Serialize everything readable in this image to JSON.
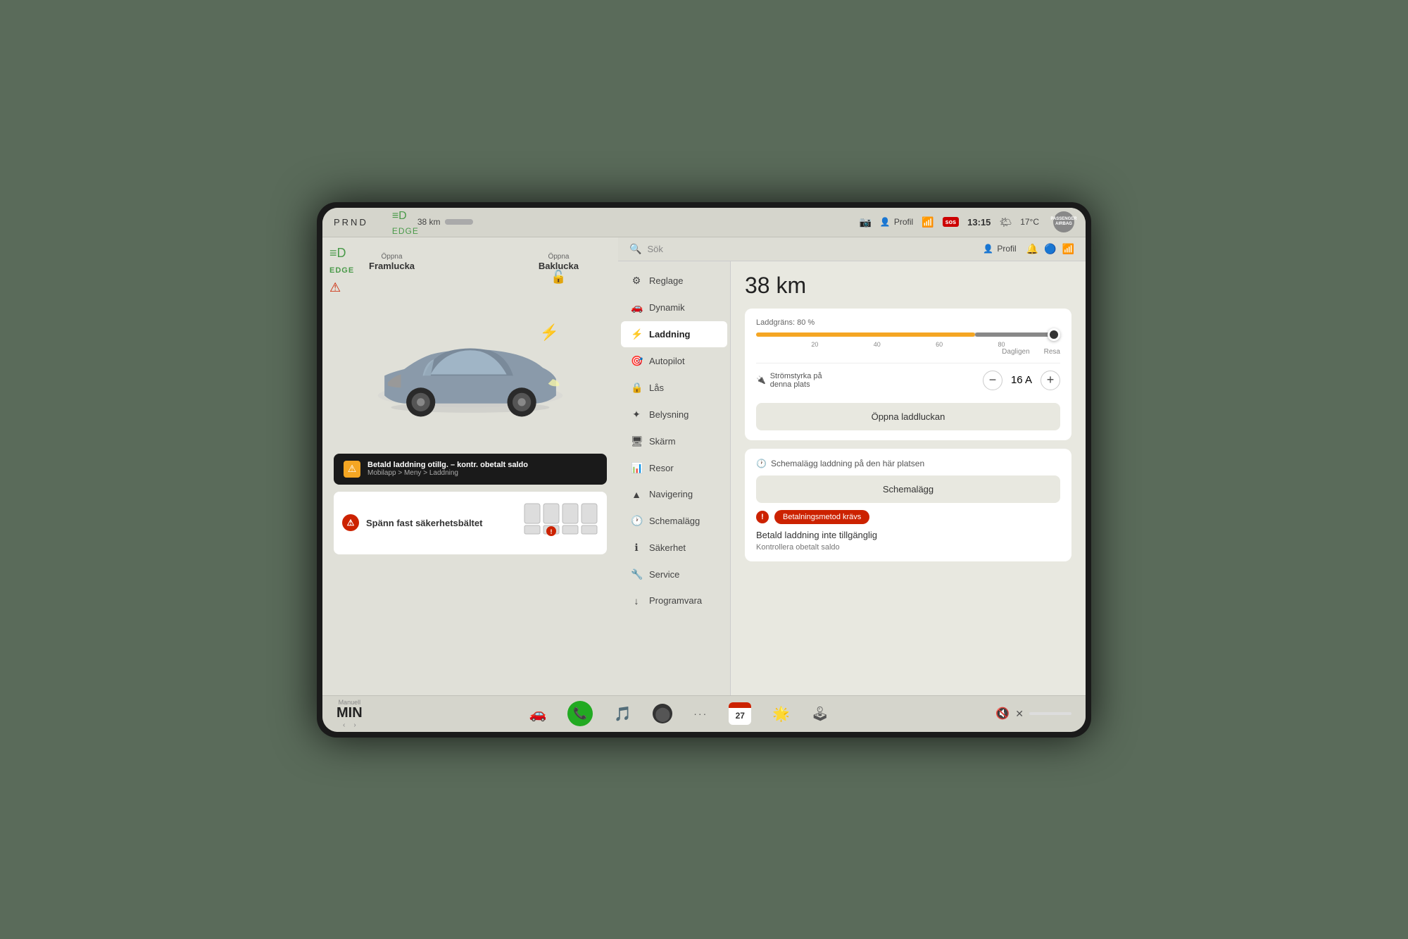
{
  "top_bar": {
    "prnd": "PRND",
    "range": "38 km",
    "profile": "Profil",
    "sos": "sos",
    "time": "13:15",
    "temp": "17°C",
    "passenger_airbag": "PASSENGER AIRBAG"
  },
  "search": {
    "placeholder": "Sök"
  },
  "top_right": {
    "profile": "Profil"
  },
  "menu": {
    "items": [
      {
        "label": "Reglage",
        "icon": "⚙",
        "active": false
      },
      {
        "label": "Dynamik",
        "icon": "🚗",
        "active": false
      },
      {
        "label": "Laddning",
        "icon": "⚡",
        "active": true
      },
      {
        "label": "Autopilot",
        "icon": "🎯",
        "active": false
      },
      {
        "label": "Lås",
        "icon": "🔒",
        "active": false
      },
      {
        "label": "Belysning",
        "icon": "☀",
        "active": false
      },
      {
        "label": "Skärm",
        "icon": "🖥",
        "active": false
      },
      {
        "label": "Resor",
        "icon": "📊",
        "active": false
      },
      {
        "label": "Navigering",
        "icon": "▲",
        "active": false
      },
      {
        "label": "Schemalägg",
        "icon": "🕐",
        "active": false
      },
      {
        "label": "Säkerhet",
        "icon": "ℹ",
        "active": false
      },
      {
        "label": "Service",
        "icon": "🔧",
        "active": false
      },
      {
        "label": "Programvara",
        "icon": "↓",
        "active": false
      }
    ]
  },
  "main": {
    "range": "38 km",
    "charge_limit_label": "Laddgräns: 80 %",
    "slider_marks": [
      "",
      "20",
      "40",
      "60",
      "80",
      ""
    ],
    "slider_modes": [
      "Dagligen",
      "Resa"
    ],
    "current_label": "Strömstyrka på\ndenna plats",
    "current_value": "16 A",
    "open_charge_btn": "Öppna laddluckan",
    "schedule_label": "Schemalägg laddning på den här platsen",
    "schedule_btn": "Schemalägg",
    "payment_error_badge": "Betalningsmetod krävs",
    "payment_title": "Betald laddning inte tillgänglig",
    "payment_sub": "Kontrollera obetalt saldo"
  },
  "left_panel": {
    "open_framlucka": "Öppna",
    "framlucka": "Framlucka",
    "open_baklucka": "Öppna",
    "baklucka": "Baklucka",
    "warning_main": "Betald laddning otillg. – kontr. obetalt saldo",
    "warning_sub": "Mobilapp > Meny > Laddning",
    "seatbelt_text": "Spänn fast säkerhetsbältet"
  },
  "bottom_bar": {
    "calendar_date": "27",
    "gear_label": "Manuell",
    "gear_value": "MIN"
  },
  "colors": {
    "active_menu_bg": "#ffffff",
    "warning_red": "#cc2200",
    "orange": "#f5a623",
    "green": "#22aa22"
  }
}
